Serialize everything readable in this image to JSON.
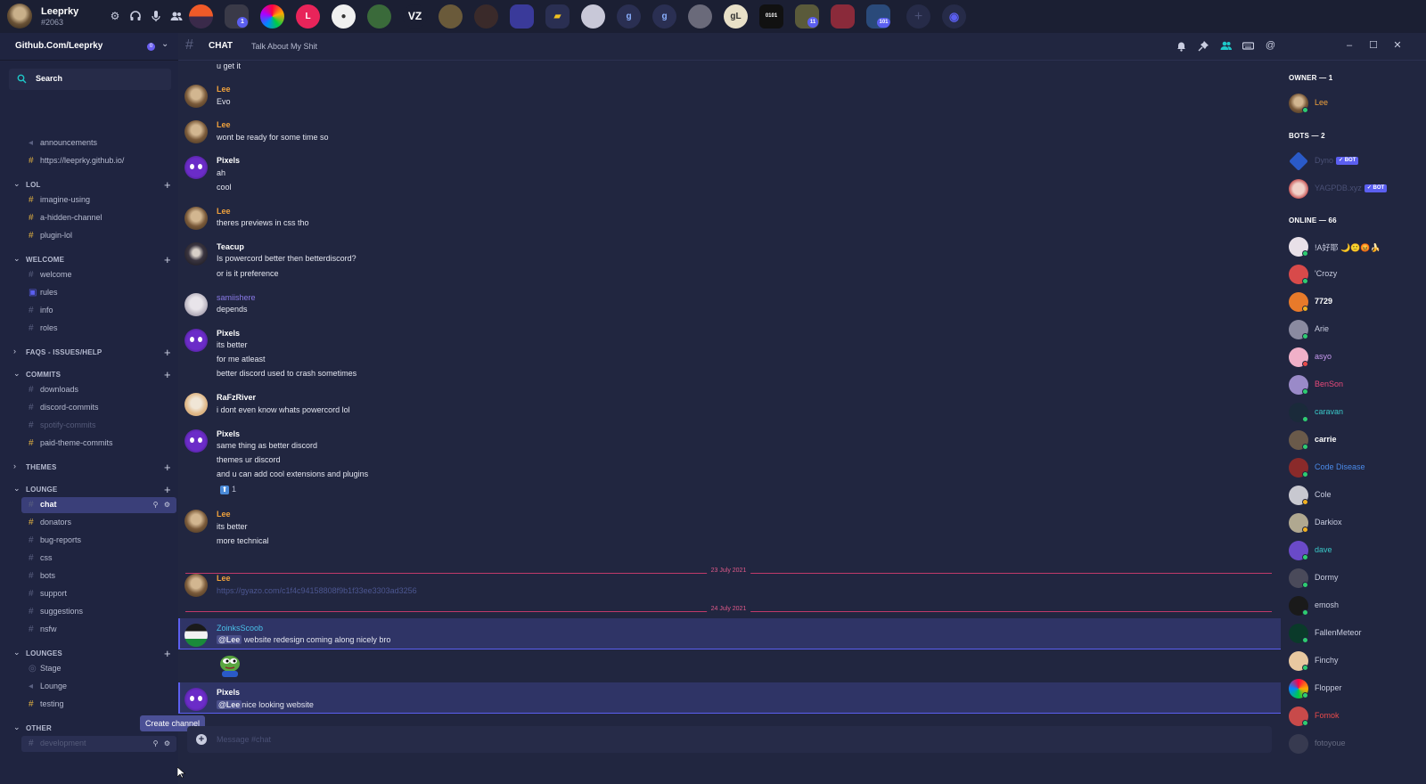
{
  "user": {
    "name": "Leeprky",
    "tag": "#2063"
  },
  "server_strip": {
    "badges": {
      "server_2": "1",
      "server_19": "11",
      "server_21": "101"
    }
  },
  "guild": {
    "name": "Github.Com/Leeprky",
    "badge": "0"
  },
  "search": {
    "label": "Search"
  },
  "channels_top": [
    {
      "name": "announcements",
      "icon": "megaphone-icon"
    },
    {
      "name": "https://leeprky.github.io/",
      "icon": "hash-sparkle-icon"
    }
  ],
  "categories": {
    "lol": {
      "name": "LOL",
      "channels": [
        "imagine-using",
        "a-hidden-channel",
        "plugin-lol"
      ]
    },
    "welcome": {
      "name": "WELCOME",
      "channels": [
        "welcome",
        "rules",
        "info",
        "roles"
      ]
    },
    "faqs": {
      "name": "FAQS - ISSUES/HELP"
    },
    "commits": {
      "name": "COMMITS",
      "channels": [
        "downloads",
        "discord-commits",
        "spotify-commits",
        "paid-theme-commits"
      ]
    },
    "themes": {
      "name": "THEMES"
    },
    "lounge": {
      "name": "LOUNGE",
      "channels": [
        "chat",
        "donators",
        "bug-reports",
        "css",
        "bots",
        "support",
        "suggestions",
        "nsfw"
      ]
    },
    "lounges": {
      "name": "LOUNGES",
      "channels": [
        "Stage",
        "Lounge",
        "testing"
      ]
    },
    "other": {
      "name": "OTHER",
      "channels": [
        "development"
      ]
    }
  },
  "tooltip": "Create channel",
  "header": {
    "channel": "CHAT",
    "topic": "Talk About My Shit"
  },
  "colors": {
    "accent": "#5b5ff0",
    "owner": "#f0a23c",
    "divider": "#c03a6a",
    "bot_tag": "#5b5ff0"
  },
  "messages": [
    {
      "lines": [
        "u get it"
      ]
    },
    {
      "author": "Lee",
      "lines": [
        "Evo"
      ]
    },
    {
      "author": "Lee",
      "lines": [
        "wont be ready for some time so"
      ]
    },
    {
      "author": "Pixels",
      "lines": [
        "ah",
        "cool"
      ]
    },
    {
      "author": "Lee",
      "lines": [
        "theres previews in css tho"
      ]
    },
    {
      "author": "Teacup",
      "lines": [
        "Is powercord better then betterdiscord?",
        "or is it preference"
      ]
    },
    {
      "author": "samiishere",
      "lines": [
        "depends"
      ]
    },
    {
      "author": "Pixels",
      "lines": [
        "its better",
        "for me atleast",
        "better discord used to crash sometimes"
      ]
    },
    {
      "author": "RaFzRiver",
      "lines": [
        "i dont even know whats powercord lol"
      ]
    },
    {
      "author": "Pixels",
      "lines": [
        "same thing as better discord",
        "themes ur discord",
        "and u can add cool extensions and plugins"
      ],
      "reaction": {
        "emoji": "⬆",
        "count": "1"
      }
    },
    {
      "author": "Lee",
      "lines": [
        "its better",
        "more technical"
      ]
    },
    {
      "divider": "23 July 2021"
    },
    {
      "author": "Lee",
      "lines": [
        "https://gyazo.com/c1f4c94158808f9b1f33ee3303ad3256"
      ]
    },
    {
      "divider": "24 July 2021"
    },
    {
      "author": "ZoinksScoob",
      "mention": "@Lee",
      "lines": [
        "website redesign coming along nicely bro"
      ]
    },
    {
      "author": "Pixels",
      "mention": "@Lee",
      "lines": [
        "nice looking website"
      ]
    }
  ],
  "composer": {
    "placeholder": "Message #chat"
  },
  "members": {
    "owner_section": "OWNER — 1",
    "owner": [
      {
        "name": "Lee"
      }
    ],
    "bots_section": "BOTS — 2",
    "bots": [
      {
        "name": "Dyno",
        "tag": "✓ BOT"
      },
      {
        "name": "YAGPDB.xyz",
        "tag": "✓ BOT"
      }
    ],
    "online_section": "ONLINE — 66",
    "online": [
      {
        "name": "!A好耶 🌙🙂😡🍌"
      },
      {
        "name": "'Crozy"
      },
      {
        "name": "7729"
      },
      {
        "name": "Arie"
      },
      {
        "name": "asyo"
      },
      {
        "name": "BenSon"
      },
      {
        "name": "caravan"
      },
      {
        "name": "carrie"
      },
      {
        "name": "Code Disease"
      },
      {
        "name": "Cole"
      },
      {
        "name": "Darkiox"
      },
      {
        "name": "dave"
      },
      {
        "name": "Dormy"
      },
      {
        "name": "emosh"
      },
      {
        "name": "FallenMeteor"
      },
      {
        "name": "Finchy"
      },
      {
        "name": "Flopper"
      },
      {
        "name": "Fomok"
      },
      {
        "name": "fotoyoue"
      }
    ]
  }
}
